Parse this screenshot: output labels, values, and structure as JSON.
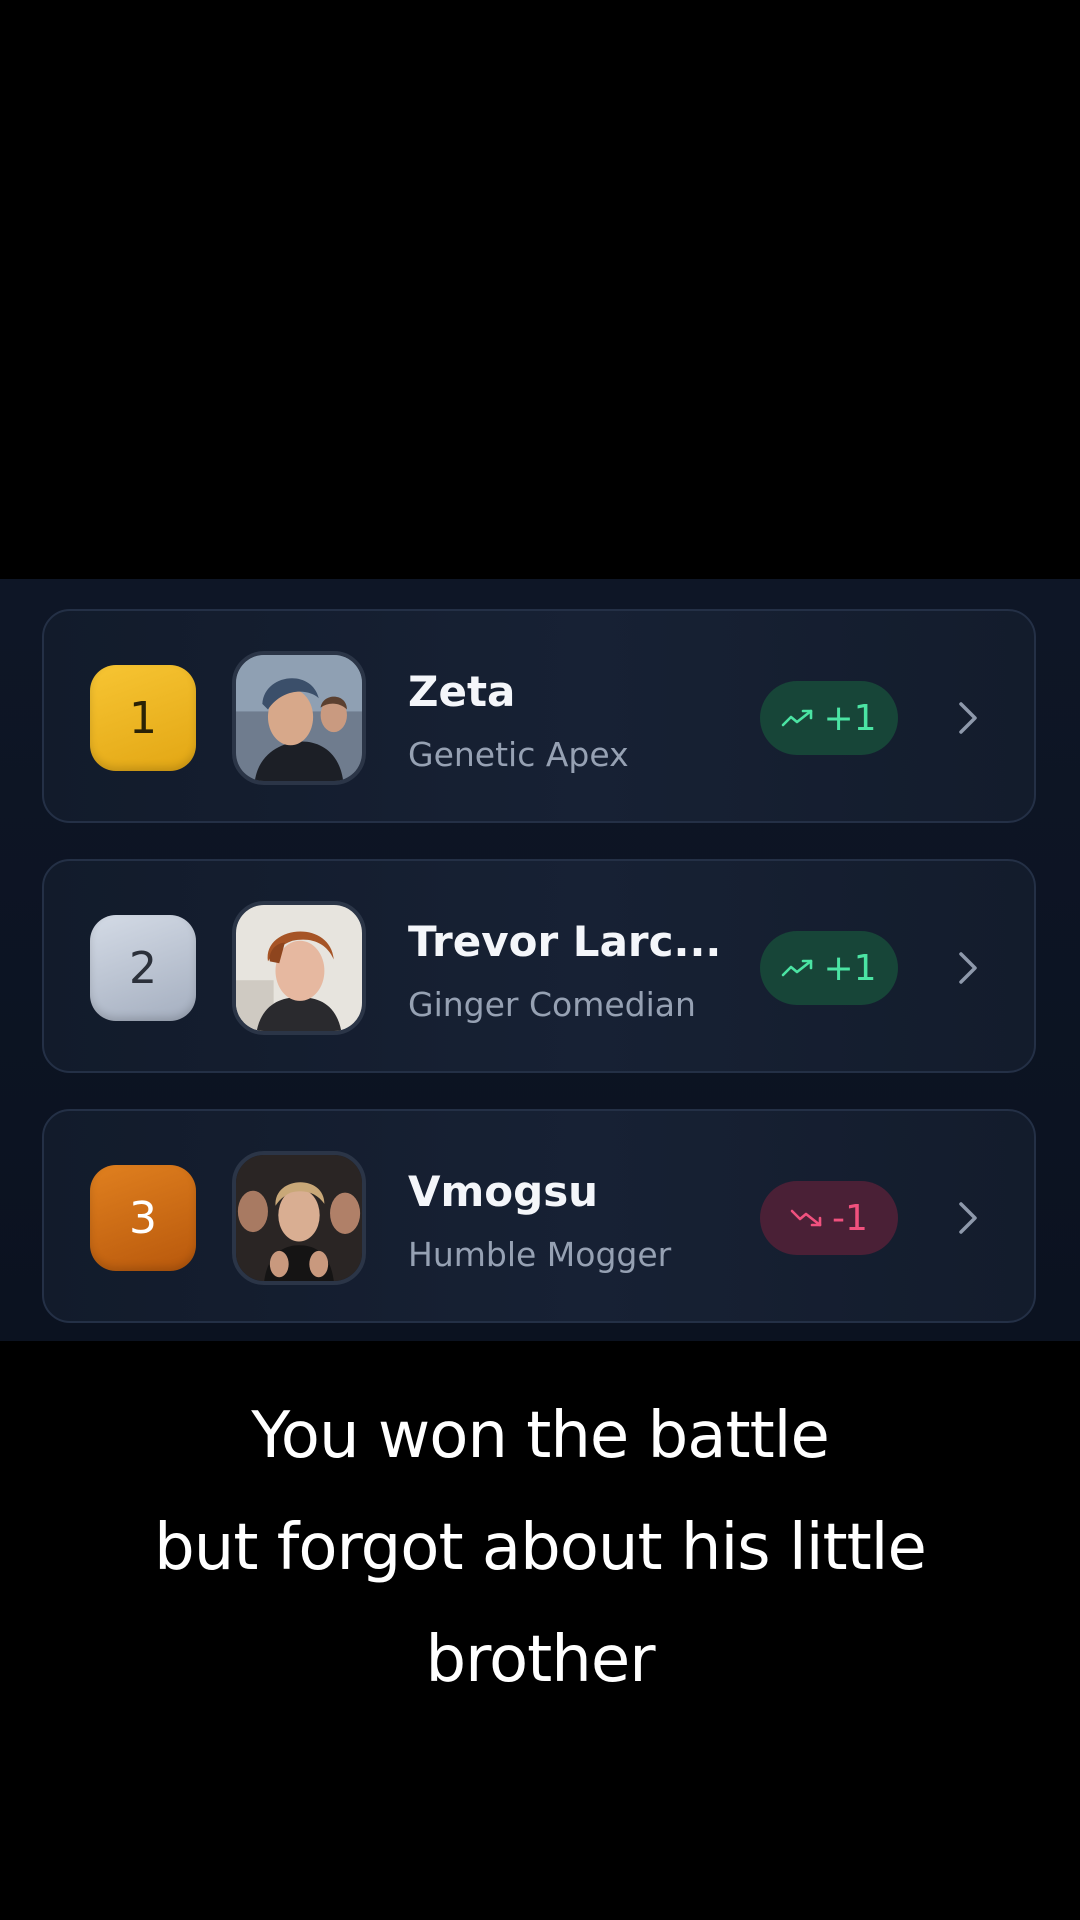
{
  "leaderboard": {
    "rows": [
      {
        "rank": "1",
        "name": "Zeta",
        "title": "Genetic Apex",
        "change": "+1",
        "direction": "up",
        "rank_color": "#f0b81f",
        "avatar_icon": "profile-photo"
      },
      {
        "rank": "2",
        "name": "Trevor Larc...",
        "title": "Ginger Comedian",
        "change": "+1",
        "direction": "up",
        "rank_color": "#b8c1cf",
        "avatar_icon": "profile-photo"
      },
      {
        "rank": "3",
        "name": "Vmogsu",
        "title": "Humble Mogger",
        "change": "-1",
        "direction": "down",
        "rank_color": "#cc6a14",
        "avatar_icon": "profile-photo"
      }
    ]
  },
  "caption": {
    "line1": "You won the battle",
    "line2": "but forgot about his little",
    "line3": "brother"
  },
  "colors": {
    "up_badge_bg": "#174538",
    "up_text": "#4be3a3",
    "down_badge_bg": "#4a2036",
    "down_text": "#f0517e"
  }
}
